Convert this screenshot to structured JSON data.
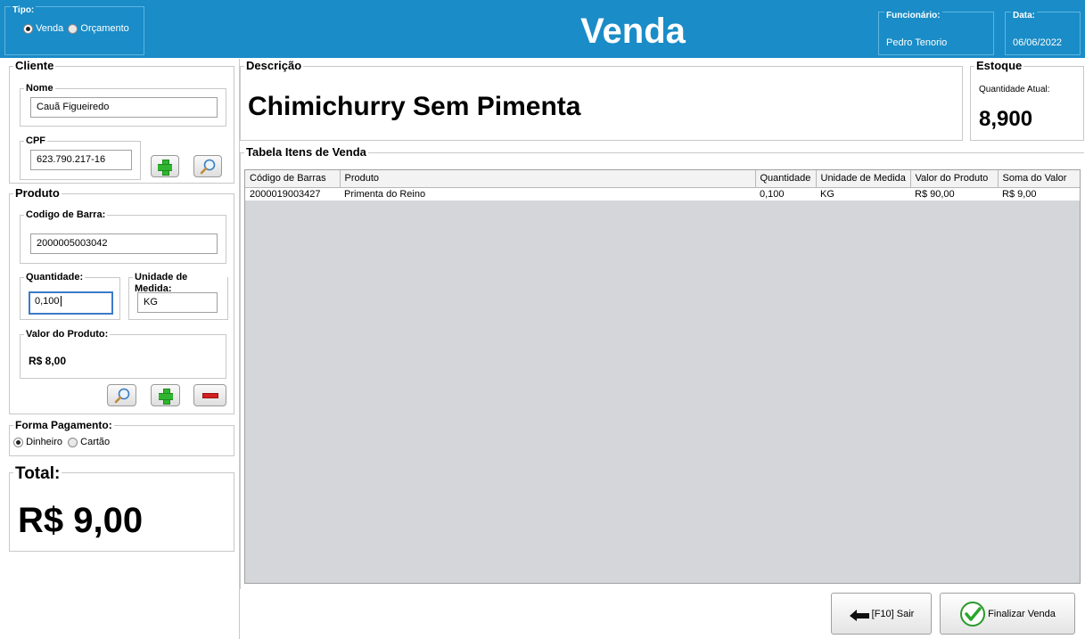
{
  "header": {
    "title": "Venda",
    "tipo_legend": "Tipo:",
    "tipo_options": [
      {
        "label": "Venda",
        "checked": true
      },
      {
        "label": "Orçamento",
        "checked": false
      }
    ],
    "funcionario_legend": "Funcionário:",
    "funcionario_value": "Pedro Tenorio",
    "data_legend": "Data:",
    "data_value": "06/06/2022",
    "colors": {
      "background": "#1a8cc7"
    }
  },
  "cliente": {
    "legend": "Cliente",
    "nome_legend": "Nome",
    "nome_value": "Cauã Figueiredo",
    "cpf_legend": "CPF",
    "cpf_value": "623.790.217-16"
  },
  "produto": {
    "legend": "Produto",
    "codigo_legend": "Codigo de Barra:",
    "codigo_value": "2000005003042",
    "quantidade_legend": "Quantidade:",
    "quantidade_value": "0,100",
    "unidade_legend": "Unidade de Medida:",
    "unidade_value": "KG",
    "valor_legend": "Valor do Produto:",
    "valor_value": "R$ 8,00"
  },
  "pagamento": {
    "legend": "Forma Pagamento:",
    "options": [
      {
        "label": "Dinheiro",
        "checked": true
      },
      {
        "label": "Cartão",
        "checked": false
      }
    ]
  },
  "total": {
    "legend": "Total:",
    "value": "R$ 9,00"
  },
  "descricao": {
    "legend": "Descrição",
    "value": "Chimichurry Sem Pimenta"
  },
  "estoque": {
    "legend": "Estoque",
    "label": "Quantidade Atual:",
    "value": "8,900"
  },
  "tabela": {
    "legend": "Tabela Itens de Venda",
    "columns": [
      "Código de Barras",
      "Produto",
      "Quantidade",
      "Unidade de Medida",
      "Valor do Produto",
      "Soma do Valor"
    ],
    "rows": [
      [
        "2000019003427",
        "Primenta do Reino",
        "0,100",
        "KG",
        "R$ 90,00",
        "R$ 9,00"
      ]
    ]
  },
  "actions": {
    "sair_label": "[F10] Sair",
    "finalizar_label": "Finalizar Venda"
  }
}
